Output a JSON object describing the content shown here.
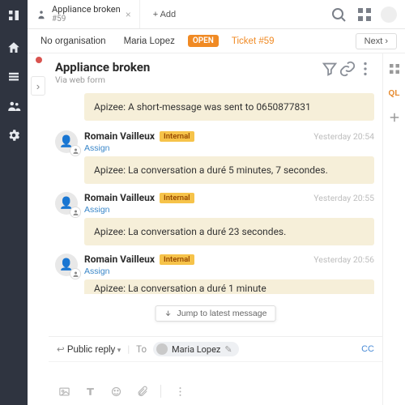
{
  "tab": {
    "title": "Appliance broken",
    "sub": "#59",
    "add_label": "+  Add"
  },
  "crumbs": {
    "org": "No organisation",
    "user": "Maria Lopez",
    "open": "OPEN",
    "ticket": "Ticket #59",
    "next": "Next"
  },
  "ticket": {
    "title": "Appliance broken",
    "source": "Via web form"
  },
  "first_note": "Apizee: A short-message was sent to 0650877831",
  "msgs": [
    {
      "author": "Romain Vailleux",
      "badge": "Internal",
      "time": "Yesterday 20:54",
      "assign": "Assign",
      "body": "Apizee: La conversation a duré 5 minutes, 7 secondes."
    },
    {
      "author": "Romain Vailleux",
      "badge": "Internal",
      "time": "Yesterday 20:55",
      "assign": "Assign",
      "body": "Apizee: La conversation a duré 23 secondes."
    },
    {
      "author": "Romain Vailleux",
      "badge": "Internal",
      "time": "Yesterday 20:56",
      "assign": "Assign",
      "body": "Apizee: La conversation a duré 1 minute"
    }
  ],
  "jump": "Jump to latest message",
  "reply": {
    "mode": "Public reply",
    "to": "To",
    "recipient": "Maria Lopez",
    "cc": "CC"
  }
}
